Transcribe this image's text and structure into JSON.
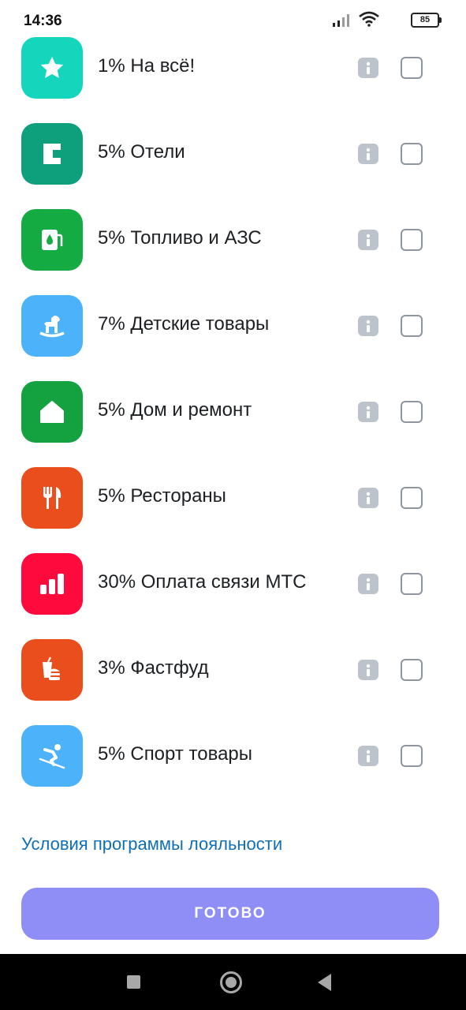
{
  "status_bar": {
    "time": "14:36",
    "battery": "85"
  },
  "categories": [
    {
      "label": "1% На всё!",
      "icon": "star-icon",
      "color": "#14d6bd"
    },
    {
      "label": "5% Отели",
      "icon": "hotel-icon",
      "color": "#0e9f7c"
    },
    {
      "label": "5% Топливо и АЗС",
      "icon": "fuel-station-icon",
      "color": "#14ab43"
    },
    {
      "label": "7% Детские товары",
      "icon": "rocking-horse-icon",
      "color": "#4cb3fb"
    },
    {
      "label": "5% Дом и ремонт",
      "icon": "house-icon",
      "color": "#14a13f"
    },
    {
      "label": "5% Рестораны",
      "icon": "fork-knife-icon",
      "color": "#ea4e1c"
    },
    {
      "label": "30% Оплата связи МТС",
      "icon": "signal-bars-icon",
      "color": "#ff0a3c"
    },
    {
      "label": "3% Фастфуд",
      "icon": "burger-drink-icon",
      "color": "#ea4e1c"
    },
    {
      "label": "5% Спорт товары",
      "icon": "skier-icon",
      "color": "#4cb3fb"
    }
  ],
  "loyalty_link": "Условия программы лояльности",
  "done_button": "ГОТОВО",
  "colors": {
    "accent_button": "#8f8ef7",
    "link": "#0f6fb5"
  }
}
